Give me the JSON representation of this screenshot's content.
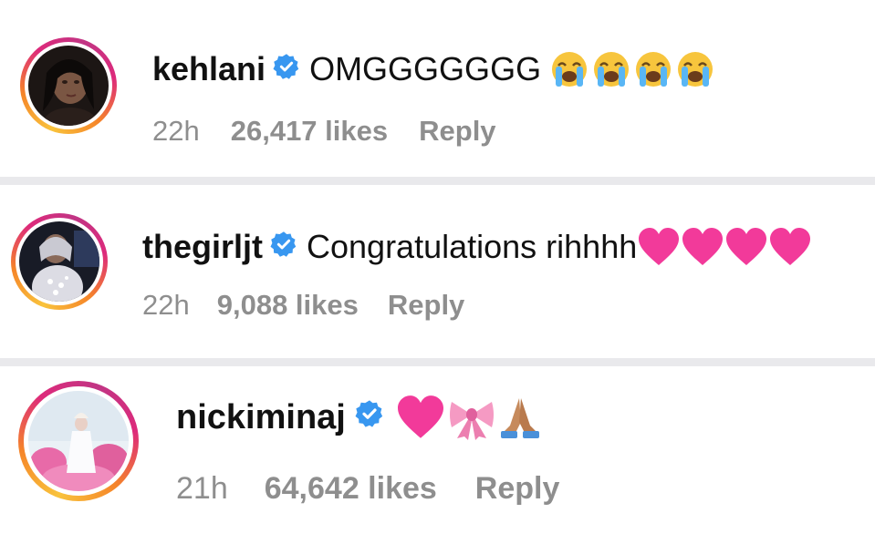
{
  "colors": {
    "verified_blue": "#3897f0",
    "meta_gray": "#8e8e8e",
    "heart_pink": "#f23a9a",
    "divider": "#e9e9ec"
  },
  "comments": [
    {
      "username": "kehlani",
      "verified": true,
      "text": "OMGGGGGGG",
      "emojis": [
        "loudly-crying-face",
        "loudly-crying-face",
        "loudly-crying-face",
        "loudly-crying-face"
      ],
      "time": "22h",
      "likes": "26,417 likes",
      "reply": "Reply"
    },
    {
      "username": "thegirljt",
      "verified": true,
      "text": "Congratulations rihhhh",
      "emojis": [
        "pink-heart",
        "pink-heart",
        "pink-heart",
        "pink-heart"
      ],
      "time": "22h",
      "likes": "9,088 likes",
      "reply": "Reply"
    },
    {
      "username": "nickiminaj",
      "verified": true,
      "text": "",
      "emojis": [
        "pink-heart",
        "pink-ribbon",
        "folded-hands"
      ],
      "time": "21h",
      "likes": "64,642 likes",
      "reply": "Reply"
    }
  ]
}
